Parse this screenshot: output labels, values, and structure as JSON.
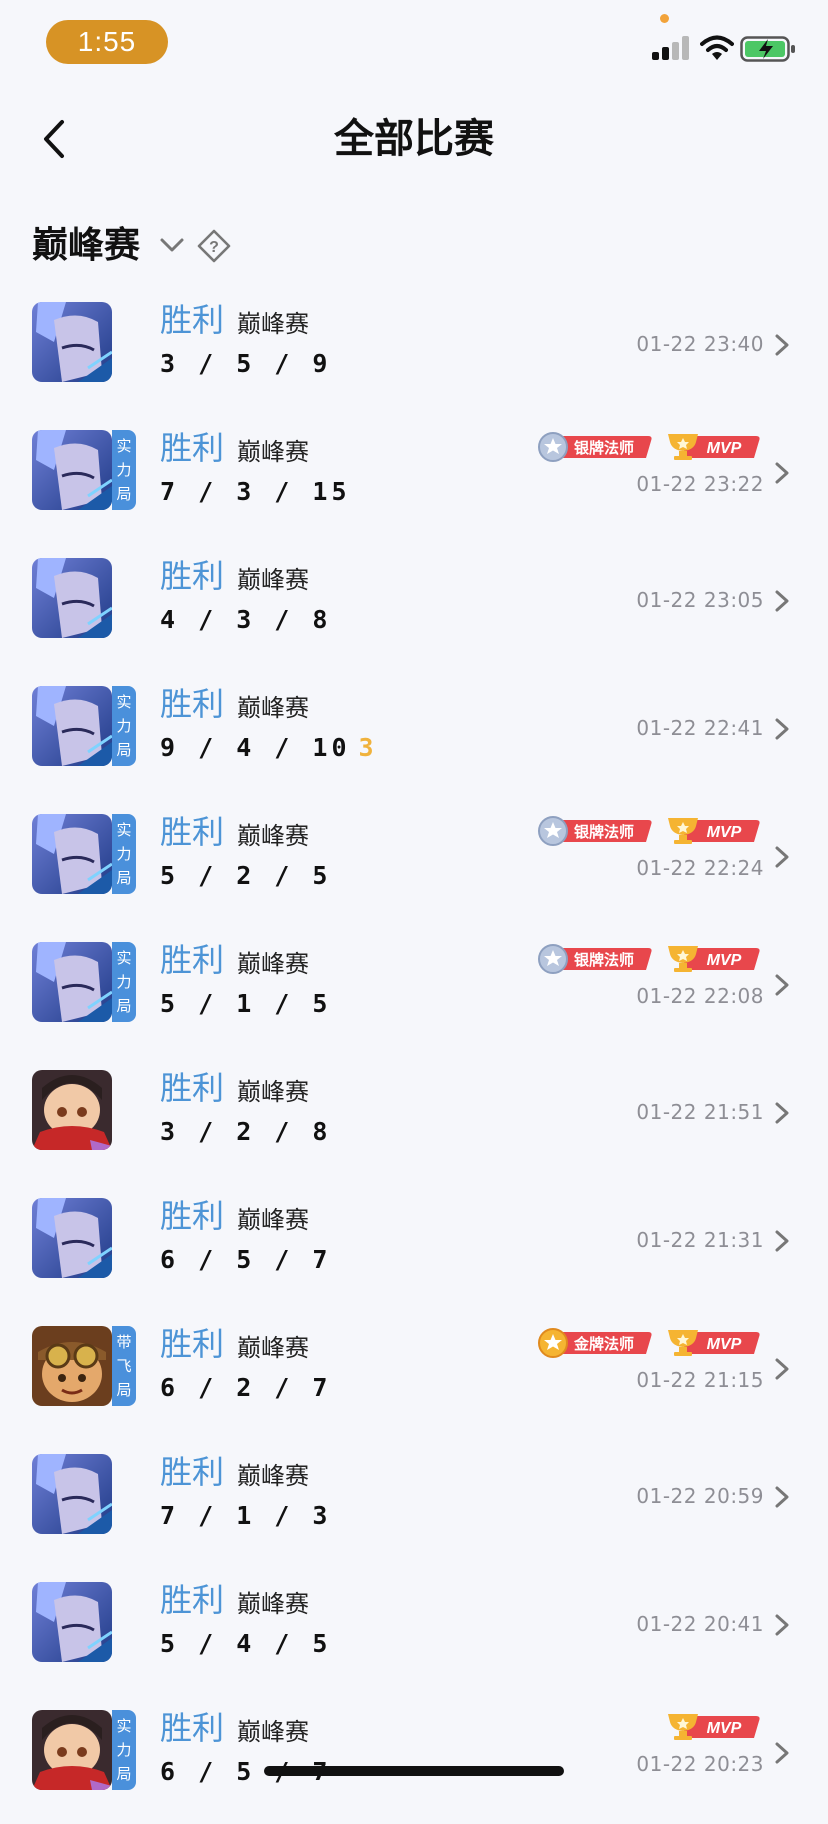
{
  "status_bar": {
    "time": "1:55"
  },
  "header": {
    "title": "全部比赛"
  },
  "filter": {
    "label": "巅峰赛"
  },
  "colors": {
    "win_blue": "#4d94d6",
    "tag_blue": "#4a90db",
    "time_pill": "#d79325",
    "mvp_red": "#e8474c",
    "gold": "#f0b23c"
  },
  "matches": [
    {
      "hero": "blue-hero",
      "tag": [],
      "result": "胜利",
      "mode": "巅峰赛",
      "kda": "3 / 5 / 9",
      "extra": "",
      "badges": [],
      "time": "01-22 23:40"
    },
    {
      "hero": "blue-hero",
      "tag": [
        "实",
        "力",
        "局"
      ],
      "result": "胜利",
      "mode": "巅峰赛",
      "kda": "7 / 3 / 15",
      "extra": "",
      "badges": [
        "银牌法师",
        "MVP"
      ],
      "time": "01-22 23:22"
    },
    {
      "hero": "blue-hero",
      "tag": [],
      "result": "胜利",
      "mode": "巅峰赛",
      "kda": "4 / 3 / 8",
      "extra": "",
      "badges": [],
      "time": "01-22 23:05"
    },
    {
      "hero": "blue-hero",
      "tag": [
        "实",
        "力",
        "局"
      ],
      "result": "胜利",
      "mode": "巅峰赛",
      "kda": "9 / 4 / 10",
      "extra": "3",
      "badges": [],
      "time": "01-22 22:41"
    },
    {
      "hero": "blue-hero",
      "tag": [
        "实",
        "力",
        "局"
      ],
      "result": "胜利",
      "mode": "巅峰赛",
      "kda": "5 / 2 / 5",
      "extra": "",
      "badges": [
        "银牌法师",
        "MVP"
      ],
      "time": "01-22 22:24"
    },
    {
      "hero": "blue-hero",
      "tag": [
        "实",
        "力",
        "局"
      ],
      "result": "胜利",
      "mode": "巅峰赛",
      "kda": "5 / 1 / 5",
      "extra": "",
      "badges": [
        "银牌法师",
        "MVP"
      ],
      "time": "01-22 22:08"
    },
    {
      "hero": "red-scarf-hero",
      "tag": [],
      "result": "胜利",
      "mode": "巅峰赛",
      "kda": "3 / 2 / 8",
      "extra": "",
      "badges": [],
      "time": "01-22 21:51"
    },
    {
      "hero": "blue-hero",
      "tag": [],
      "result": "胜利",
      "mode": "巅峰赛",
      "kda": "6 / 5 / 7",
      "extra": "",
      "badges": [],
      "time": "01-22 21:31"
    },
    {
      "hero": "goggles-hero",
      "tag": [
        "带",
        "飞",
        "局"
      ],
      "result": "胜利",
      "mode": "巅峰赛",
      "kda": "6 / 2 / 7",
      "extra": "",
      "badges": [
        "金牌法师",
        "MVP"
      ],
      "time": "01-22 21:15"
    },
    {
      "hero": "blue-hero",
      "tag": [],
      "result": "胜利",
      "mode": "巅峰赛",
      "kda": "7 / 1 / 3",
      "extra": "",
      "badges": [],
      "time": "01-22 20:59"
    },
    {
      "hero": "blue-hero",
      "tag": [],
      "result": "胜利",
      "mode": "巅峰赛",
      "kda": "5 / 4 / 5",
      "extra": "",
      "badges": [],
      "time": "01-22 20:41"
    },
    {
      "hero": "red-scarf-hero",
      "tag": [
        "实",
        "力",
        "局"
      ],
      "result": "胜利",
      "mode": "巅峰赛",
      "kda": "6 / 5 / 7",
      "extra": "",
      "badges": [
        "MVP"
      ],
      "time": "01-22 20:23"
    }
  ]
}
